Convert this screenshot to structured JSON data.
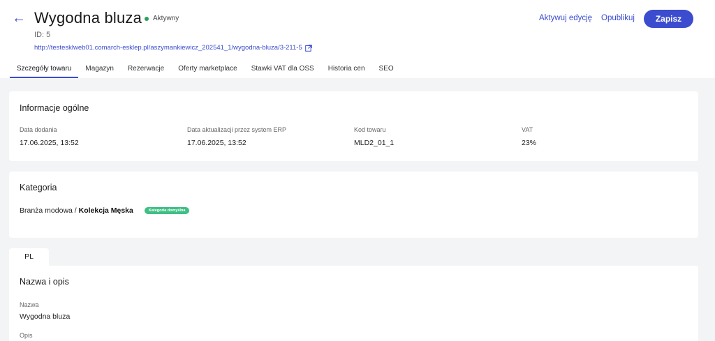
{
  "header": {
    "back_icon": "arrow-left-icon",
    "title": "Wygodna bluza",
    "status": "Aktywny",
    "status_color": "#2e9e5b",
    "id_line": "ID: 5",
    "url": "http://testesklweb01.comarch-esklep.pl/aszymankiewicz_202541_1/wygodna-bluza/3-211-5",
    "external_icon": "external-link-icon",
    "activate_edit": "Aktywuj edycję",
    "publish": "Opublikuj",
    "save": "Zapisz",
    "accent": "#3b4ccf"
  },
  "tabs": [
    {
      "label": "Szczegóły towaru",
      "active": true
    },
    {
      "label": "Magazyn"
    },
    {
      "label": "Rezerwacje"
    },
    {
      "label": "Oferty marketplace"
    },
    {
      "label": "Stawki VAT dla OSS"
    },
    {
      "label": "Historia cen"
    },
    {
      "label": "SEO"
    }
  ],
  "general": {
    "title": "Informacje ogólne",
    "fields": [
      {
        "label": "Data dodania",
        "value": "17.06.2025, 13:52"
      },
      {
        "label": "Data aktualizacji przez system ERP",
        "value": "17.06.2025, 13:52"
      },
      {
        "label": "Kod towaru",
        "value": "MLD2_01_1"
      },
      {
        "label": "VAT",
        "value": "23%"
      }
    ]
  },
  "category": {
    "title": "Kategoria",
    "path_prefix": "Branża modowa / ",
    "path_leaf": "Kolekcja Męska",
    "badge": "Kategoria domyślna",
    "badge_color": "#3fbf84"
  },
  "description": {
    "lang_tab": "PL",
    "title": "Nazwa i opis",
    "name_label": "Nazwa",
    "name_value": "Wygodna bluza",
    "desc_label": "Opis"
  }
}
